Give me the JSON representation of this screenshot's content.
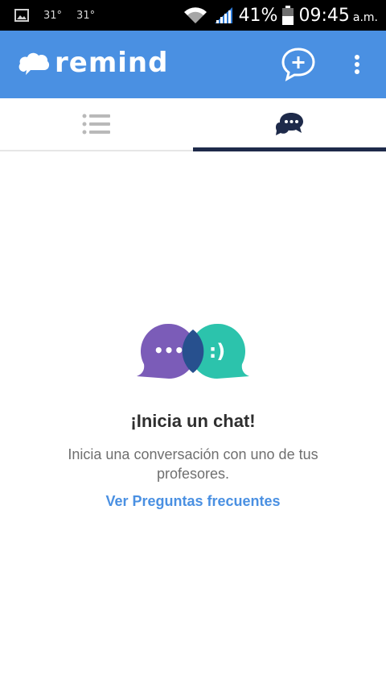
{
  "status_bar": {
    "temp_1": "31°",
    "temp_2": "31°",
    "battery_percent": "41%",
    "time": "09:45",
    "ampm": "a.m."
  },
  "app_bar": {
    "logo_text": "remind",
    "brand_color": "#4a90e2",
    "icons": [
      "cloud-logo-icon",
      "new-chat-icon",
      "overflow-menu-icon"
    ]
  },
  "tabs": [
    {
      "name": "list",
      "icon": "list-icon",
      "selected": false
    },
    {
      "name": "chats",
      "icon": "chat-bubbles-icon",
      "selected": true
    }
  ],
  "empty_state": {
    "title": "¡Inicia un chat!",
    "description": "Inicia una conversación con uno de tus profesores.",
    "link": "Ver Preguntas frecuentes",
    "illustration_left_text": "•••",
    "illustration_right_text": ":)"
  },
  "colors": {
    "accent": "#4a90e2",
    "tab_indicator": "#1e2a4a",
    "bubble_purple": "#7b5cb8",
    "bubble_teal": "#2cc3ac",
    "bubble_overlap": "#27508e"
  }
}
